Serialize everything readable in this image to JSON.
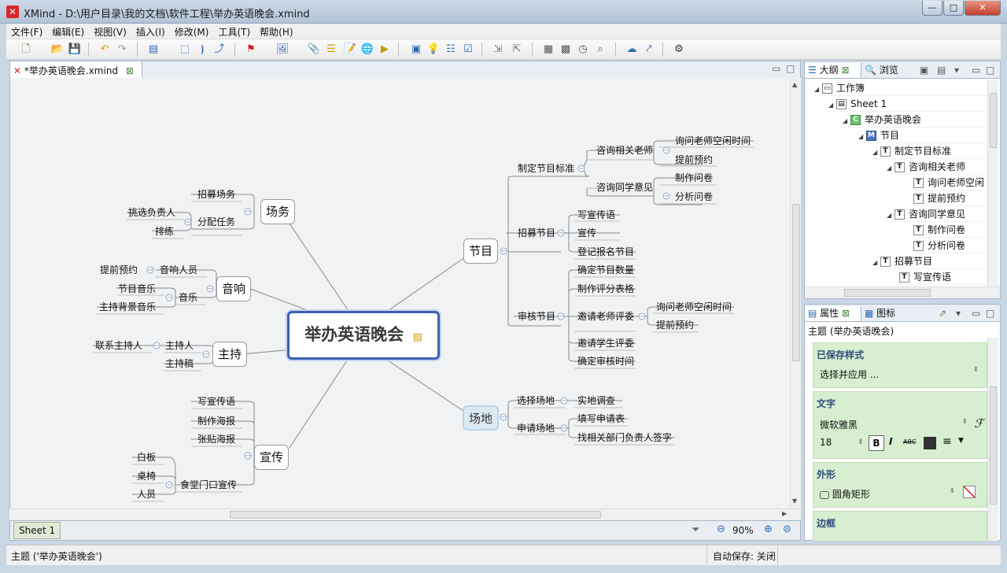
{
  "window": {
    "title": "XMind - D:\\用户目录\\我的文档\\软件工程\\举办英语晚会.xmind",
    "app_icon": "xmind-logo-icon",
    "controls": {
      "minimize": "—",
      "maximize": "□",
      "close": "✕"
    }
  },
  "menu": [
    "文件(F)",
    "编辑(E)",
    "视图(V)",
    "插入(I)",
    "修改(M)",
    "工具(T)",
    "帮助(H)"
  ],
  "editor": {
    "tab_title": "*举办英语晚会.xmind",
    "sheet_tab": "Sheet 1",
    "zoom": "90%"
  },
  "mindmap": {
    "central": "举办英语晚会",
    "topics": {
      "jiemu": "节目",
      "changdi": "场地",
      "changwu": "场务",
      "yinxiang": "音响",
      "zhuchi": "主持",
      "xuanchuan": "宣传"
    },
    "jiemu_sub": {
      "standard": "制定节目标准",
      "ask_teacher": "咨询相关老师",
      "ask_teacher_time": "询问老师空闲时间",
      "ask_teacher_book": "提前预约",
      "ask_student": "咨询同学意见",
      "make_survey": "制作问卷",
      "analyze_survey": "分析问卷",
      "recruit": "招募节目",
      "write_flyer": "写宣传语",
      "promote": "宣传",
      "register": "登记报名节目",
      "review": "审核节目",
      "count": "确定节目数量",
      "score_table": "制作评分表格",
      "invite_teacher": "邀请老师评委",
      "invite_teacher_time": "询问老师空闲时间",
      "invite_teacher_book": "提前预约",
      "invite_student": "邀请学生评委",
      "review_time": "确定审核时间"
    },
    "changdi_sub": {
      "choose": "选择场地",
      "survey": "实地调查",
      "apply": "申请场地",
      "fill_form": "填写申请表",
      "sign": "找相关部门负责人签字"
    },
    "changwu_sub": {
      "recruit_staff": "招募场务",
      "assign": "分配任务",
      "pick_leader": "挑选负责人",
      "rehearse": "排练"
    },
    "yinxiang_sub": {
      "sound_person": "音响人员",
      "book": "提前预约",
      "music": "音乐",
      "program_music": "节目音乐",
      "host_music": "主持背景音乐"
    },
    "zhuchi_sub": {
      "host": "主持人",
      "contact_host": "联系主持人",
      "script": "主持稿"
    },
    "xuanchuan_sub": {
      "slogan": "写宣传语",
      "make_poster": "制作海报",
      "post_poster": "张贴海报",
      "canteen": "食堂门口宣传",
      "whiteboard": "白板",
      "tables": "桌椅",
      "staff": "人员"
    }
  },
  "outline": {
    "tabs": [
      "大纲",
      "浏览"
    ],
    "rows": [
      "工作簿",
      "Sheet 1",
      "举办英语晚会",
      "节目",
      "制定节目标准",
      "咨询相关老师",
      "询问老师空闲",
      "提前预约",
      "咨询同学意见",
      "制作问卷",
      "分析问卷",
      "招募节目",
      "写宣传语"
    ]
  },
  "properties": {
    "tabs": [
      "属性",
      "图标"
    ],
    "subject": "主题 (举办英语晚会)",
    "saved_styles_title": "已保存样式",
    "saved_styles_value": "选择并应用 ...",
    "text_title": "文字",
    "font_name": "微软雅黑",
    "font_size": "18",
    "bold": "B",
    "italic": "I",
    "strike": "ABC",
    "shape_title": "外形",
    "shape_value": "圆角矩形",
    "border_title": "边框"
  },
  "status": {
    "left": "主题 ('举办英语晚会')",
    "autosave": "自动保存: 关闭"
  },
  "colors": {
    "central_border": "#3d61b3",
    "selected_fill": "#dbe9f3",
    "panel_green": "#d7efd0"
  }
}
